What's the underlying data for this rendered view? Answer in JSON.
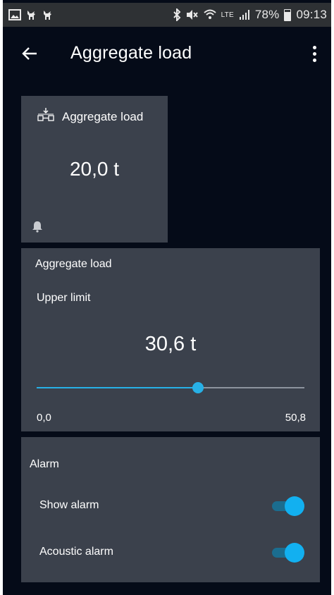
{
  "status_bar": {
    "battery": "78%",
    "time": "09:13",
    "network": "LTE",
    "icons": [
      "image-icon",
      "deer-icon",
      "deer-icon",
      "bluetooth-icon",
      "mute-icon",
      "wifi-icon",
      "signal-icon",
      "battery-icon"
    ]
  },
  "app_bar": {
    "title": "Aggregate load",
    "back_icon": "arrow-left-icon",
    "menu_icon": "more-vertical-icon"
  },
  "tile": {
    "title": "Aggregate load",
    "value": "20,0 t",
    "icon": "aggregate-load-icon",
    "bell_icon": "bell-icon"
  },
  "limit_card": {
    "title": "Aggregate load",
    "label": "Upper limit",
    "value": "30,6 t",
    "min_label": "0,0",
    "max_label": "50,8",
    "slider_min": 0.0,
    "slider_max": 50.8,
    "slider_value": 30.6
  },
  "alarm_card": {
    "title": "Alarm",
    "show_alarm_label": "Show alarm",
    "show_alarm_on": true,
    "acoustic_alarm_label": "Acoustic alarm",
    "acoustic_alarm_on": true
  },
  "colors": {
    "background": "#050b18",
    "card": "#3b414c",
    "accent": "#27b0e6",
    "status_bar": "#2e3134"
  }
}
